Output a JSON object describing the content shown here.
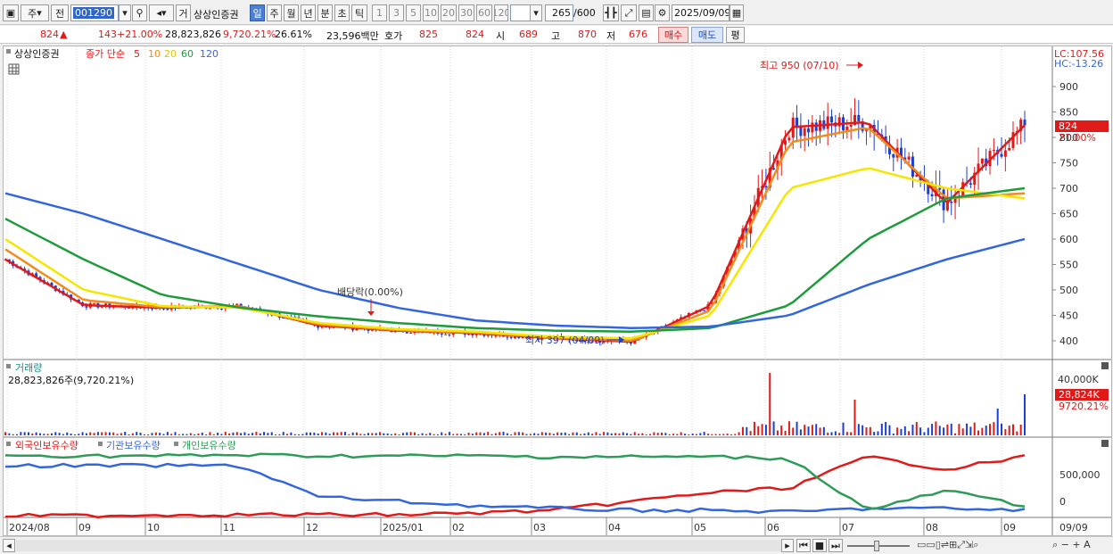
{
  "toolbar": {
    "box_code": "주",
    "box_prev": "전",
    "stock_code": "001290",
    "stock_name": "상상인증권",
    "gu_label": "거",
    "periods": [
      "일",
      "주",
      "월",
      "년",
      "분",
      "초",
      "틱"
    ],
    "active_period": "일",
    "intervals": [
      "1",
      "3",
      "5",
      "10",
      "20",
      "30",
      "60",
      "120"
    ],
    "count": "265",
    "count_total": "/600",
    "date": "2025/09/09"
  },
  "quote": {
    "price": "824",
    "arrow": "▲",
    "change": "143",
    "change_rate": "+21.00%",
    "volume": "28,823,826",
    "volume_rate": "9,720.21%",
    "turnover": "26.61%",
    "amount": "23,596백만",
    "hoga_label": "호가",
    "ask": "825",
    "bid": "824",
    "open_label": "시",
    "open": "689",
    "high_label": "고",
    "high": "870",
    "low_label": "저",
    "low": "676",
    "buy_label": "매수",
    "sell_label": "매도",
    "eval_label": "평"
  },
  "price_panel": {
    "title": "상상인증권",
    "ma_label": "종가 단순",
    "ma_periods": [
      "5",
      "10",
      "20",
      "60",
      "120"
    ],
    "lc_label": "LC:107.56",
    "hc_label": "HC:-13.26",
    "current_price_tag": "824",
    "current_rate_tag": "21.00%",
    "high_annotation": "최고 950 (07/10)",
    "low_annotation": "최저 397 (04/09)",
    "dividend_annotation": "배당락(0.00%)",
    "y_ticks": [
      "900",
      "850",
      "800",
      "750",
      "700",
      "650",
      "600",
      "550",
      "500",
      "450",
      "400"
    ]
  },
  "volume_panel": {
    "title": "거래량",
    "summary": "28,823,826주(9,720.21%)",
    "y_tick": "40,000K",
    "current_tag": "28,824K",
    "current_rate": "9720.21%"
  },
  "holding_panel": {
    "legend": [
      "외국인보유수량",
      "기관보유수량",
      "개인보유수량"
    ],
    "y_ticks": [
      "500,000",
      "0"
    ]
  },
  "x_axis": {
    "labels": [
      "2024/08",
      "09",
      "10",
      "11",
      "12",
      "2025/01",
      "02",
      "03",
      "04",
      "05",
      "06",
      "07",
      "08",
      "09"
    ],
    "end_label": "09/09"
  },
  "colors": {
    "ma5": "#e01919",
    "ma10": "#f08c1e",
    "ma20": "#f5e600",
    "ma60": "#1e9b3c",
    "ma120": "#3366dd",
    "up": "#e01919",
    "down": "#1a3fd6",
    "foreign": "#e01919",
    "institution": "#3366dd",
    "individual": "#2e9b58"
  },
  "chart_data": {
    "type": "line",
    "title": "상상인증권",
    "x": [
      "2024/08",
      "09",
      "10",
      "11",
      "12",
      "2025/01",
      "02",
      "03",
      "04",
      "05",
      "06",
      "07",
      "08",
      "09"
    ],
    "ylim": [
      380,
      930
    ],
    "series": [
      {
        "name": "5",
        "values": [
          560,
          470,
          465,
          468,
          430,
          420,
          415,
          405,
          398,
          470,
          820,
          830,
          670,
          824
        ]
      },
      {
        "name": "10",
        "values": [
          580,
          480,
          466,
          468,
          432,
          421,
          416,
          406,
          400,
          460,
          790,
          820,
          680,
          690
        ]
      },
      {
        "name": "20",
        "values": [
          600,
          500,
          468,
          465,
          435,
          423,
          418,
          408,
          405,
          450,
          700,
          740,
          700,
          680
        ]
      },
      {
        "name": "60",
        "values": [
          640,
          560,
          490,
          465,
          448,
          435,
          425,
          420,
          418,
          425,
          470,
          600,
          680,
          700
        ]
      },
      {
        "name": "120",
        "values": [
          690,
          650,
          600,
          550,
          500,
          465,
          440,
          430,
          425,
          428,
          450,
          510,
          560,
          600
        ]
      }
    ],
    "highlights": {
      "high": 950,
      "low": 397,
      "last": 824
    }
  }
}
